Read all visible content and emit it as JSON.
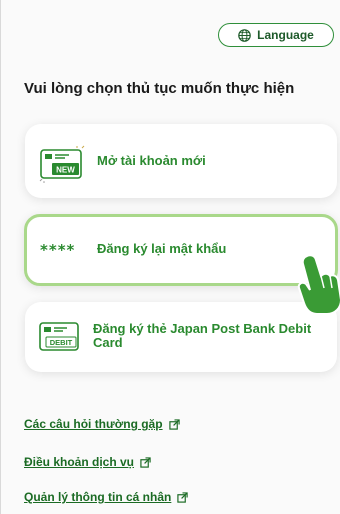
{
  "header": {
    "language_label": "Language",
    "language_icon": "globe-icon"
  },
  "prompt": "Vui lòng chọn thủ tục muốn thực hiện",
  "cards": [
    {
      "label": "Mở tài khoản mới",
      "icon": "new-account-card-icon",
      "icon_tag": "NEW"
    },
    {
      "label": "Đăng ký lại mật khẩu",
      "icon": "password-stars-icon",
      "icon_text": "****"
    },
    {
      "label": "Đăng ký thẻ Japan Post Bank Debit Card",
      "icon": "debit-card-icon",
      "icon_tag": "DEBIT"
    }
  ],
  "links": [
    {
      "label": "Các câu hỏi thường gặp",
      "icon": "external-link-icon"
    },
    {
      "label": "Điều khoản dịch vụ",
      "icon": "external-link-icon"
    },
    {
      "label": "Quản lý thông tin cá nhân",
      "icon": "external-link-icon"
    }
  ],
  "colors": {
    "accent_green": "#2a8a2f",
    "highlight_border": "#a9d88a",
    "pointer_hand": "#3a9b35"
  }
}
